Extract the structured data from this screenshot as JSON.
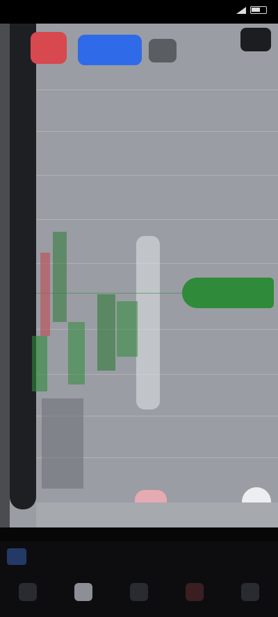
{
  "status_bar": {
    "time": "",
    "battery_icon": "battery-icon",
    "signal_icon": "signal-icon"
  },
  "toolbar": {
    "sell_label": "",
    "buy_label": "",
    "more_icon": "more-icon"
  },
  "chart": {
    "symbol": "",
    "price_labels": [
      "",
      "",
      "",
      "",
      "",
      "",
      "",
      "",
      "",
      "",
      "",
      ""
    ],
    "current_price": "",
    "colors": {
      "background": "#9a9da3",
      "bull": "#2f8a3a",
      "bear": "#c24a52",
      "rail": "#1e1f22"
    }
  },
  "info": {
    "text": ""
  },
  "nav": {
    "items": [
      {
        "label": "",
        "icon": "quotes-icon"
      },
      {
        "label": "",
        "icon": "chart-icon"
      },
      {
        "label": "",
        "icon": "trade-icon"
      },
      {
        "label": "",
        "icon": "history-icon"
      },
      {
        "label": "",
        "icon": "settings-icon"
      }
    ]
  }
}
